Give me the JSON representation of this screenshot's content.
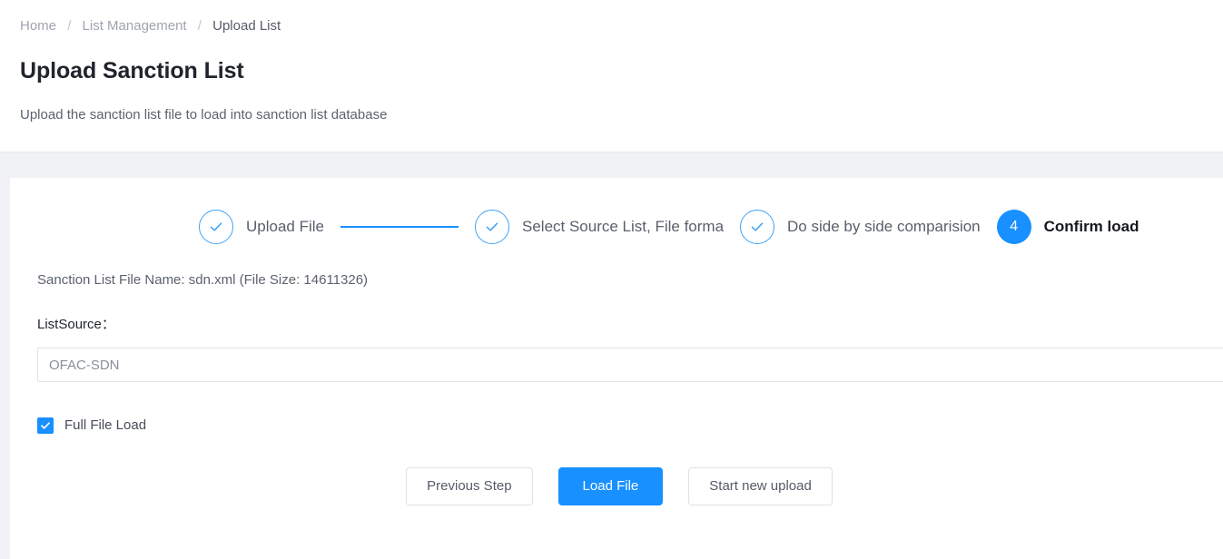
{
  "breadcrumb": {
    "items": [
      {
        "label": "Home"
      },
      {
        "label": "List Management"
      },
      {
        "label": "Upload List"
      }
    ],
    "separator": "/"
  },
  "header": {
    "title": "Upload Sanction List",
    "description": "Upload the sanction list file to load into sanction list database"
  },
  "steps": [
    {
      "label": "Upload File",
      "state": "done",
      "number": "1"
    },
    {
      "label": "Select Source List, File forma",
      "state": "done",
      "number": "2"
    },
    {
      "label": "Do side by side comparision",
      "state": "done",
      "number": "3"
    },
    {
      "label": "Confirm load",
      "state": "active",
      "number": "4"
    }
  ],
  "form": {
    "file_info": "Sanction List File Name: sdn.xml (File Size: 14611326)",
    "list_source_label": "ListSource：",
    "list_source_value": "OFAC-SDN",
    "list_source_placeholder": "",
    "full_file_load_label": "Full File Load",
    "full_file_load_checked": true
  },
  "buttons": {
    "previous": "Previous Step",
    "load": "Load File",
    "start_new": "Start new upload"
  },
  "colors": {
    "accent": "#1890ff",
    "page_bg": "#f0f2f5",
    "card_bg": "#ffffff",
    "text_primary": "#20242c",
    "text_secondary": "#5c626d",
    "border": "#dfe1e6"
  }
}
